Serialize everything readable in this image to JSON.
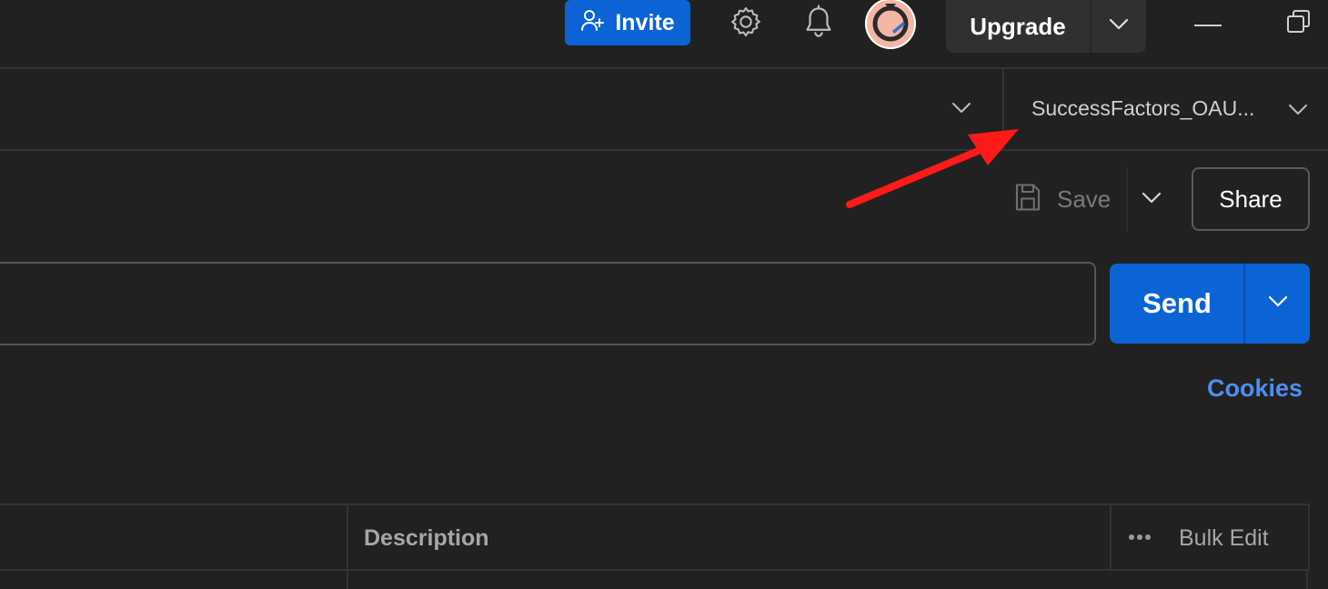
{
  "header": {
    "invite_label": "Invite",
    "upgrade_label": "Upgrade"
  },
  "environment": {
    "selected": "SuccessFactors_OAU..."
  },
  "toolbar": {
    "save_label": "Save",
    "share_label": "Share"
  },
  "request": {
    "url_value": "",
    "send_label": "Send"
  },
  "links": {
    "cookies_label": "Cookies"
  },
  "params_table": {
    "description_header": "Description",
    "bulk_edit_label": "Bulk Edit"
  },
  "colors": {
    "accent_blue": "#0b63d6",
    "link_blue": "#4d8ef0",
    "annotation_red": "#ff1a1a",
    "background": "#212121"
  },
  "icons": [
    "add-user-icon",
    "gear-icon",
    "bell-icon",
    "avatar",
    "chevron-down-icon",
    "save-icon",
    "more-horizontal-icon",
    "minimize-icon",
    "restore-icon"
  ]
}
